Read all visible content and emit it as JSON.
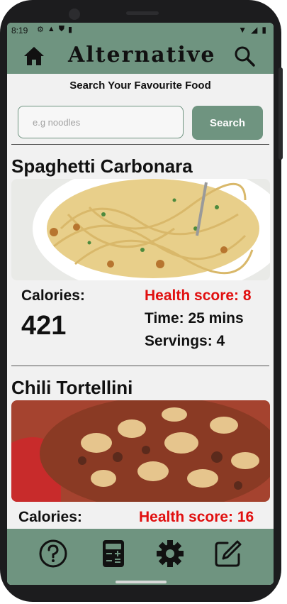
{
  "status_bar": {
    "time": "8:19",
    "left_icons": [
      "gear-icon",
      "shield-icon",
      "play-shield-icon",
      "sd-card-icon"
    ],
    "right_icons": [
      "wifi-icon",
      "signal-icon",
      "battery-icon"
    ]
  },
  "app_bar": {
    "title": "Alternative"
  },
  "search": {
    "heading": "Search Your Favourite Food",
    "placeholder": "e.g noodles",
    "value": "",
    "button_label": "Search"
  },
  "recipes": [
    {
      "name": "Spaghetti Carbonara",
      "calories_label": "Calories:",
      "calories": "421",
      "health_score": "Health score: 8",
      "time": "Time: 25 mins",
      "servings": "Servings: 4"
    },
    {
      "name": "Chili Tortellini",
      "calories_label": "Calories:",
      "health_score": "Health score: 16"
    }
  ],
  "bottom_nav": [
    {
      "icon": "help-icon"
    },
    {
      "icon": "calculator-icon"
    },
    {
      "icon": "settings-icon"
    },
    {
      "icon": "edit-icon"
    }
  ],
  "colors": {
    "accent": "#6f9480",
    "health_red": "#e11010",
    "background": "#f1f1f1"
  }
}
